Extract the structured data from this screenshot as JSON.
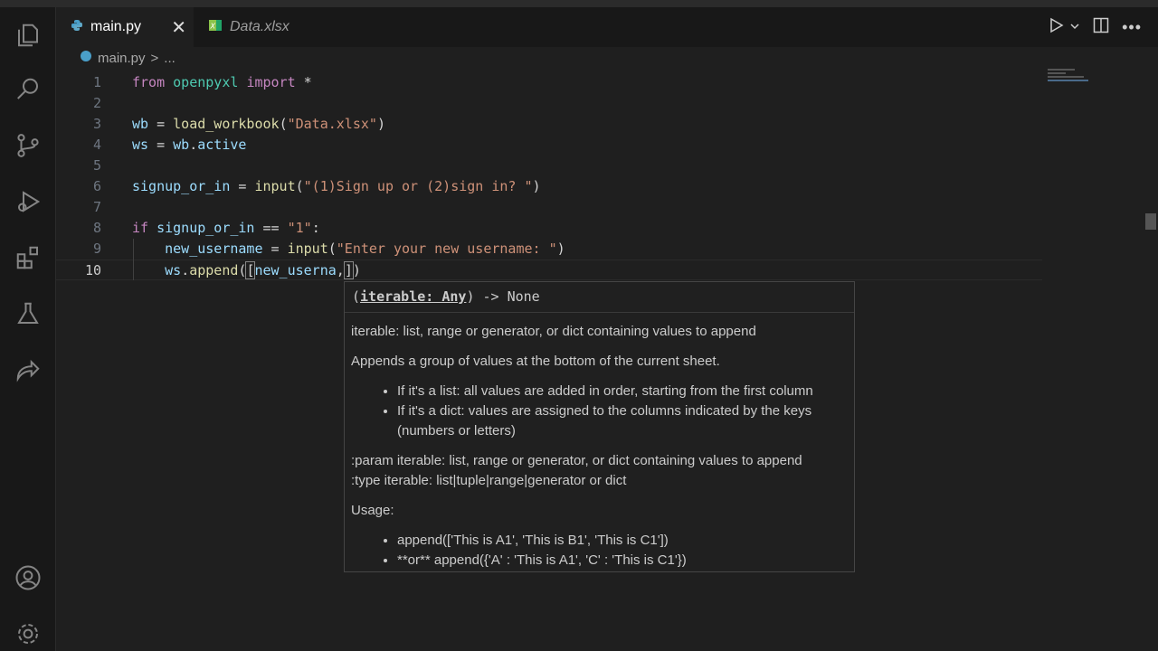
{
  "tabs": [
    {
      "label": "main.py",
      "icon": "python-icon",
      "active": true
    },
    {
      "label": "Data.xlsx",
      "icon": "excel-icon",
      "active": false
    }
  ],
  "breadcrumb": {
    "file": "main.py",
    "sep": ">",
    "rest": "..."
  },
  "lines": [
    "1",
    "2",
    "3",
    "4",
    "5",
    "6",
    "7",
    "8",
    "9",
    "10"
  ],
  "code": {
    "l1": [
      "from",
      " ",
      "openpyxl",
      " ",
      "import",
      " *"
    ],
    "l3": [
      "wb",
      " = ",
      "load_workbook",
      "(",
      "\"Data.xlsx\"",
      ")"
    ],
    "l4": [
      "ws",
      " = ",
      "wb",
      ".",
      "active"
    ],
    "l6": [
      "signup_or_in",
      " = ",
      "input",
      "(",
      "\"(1)Sign up or (2)sign in? \"",
      ")"
    ],
    "l8": [
      "if",
      " ",
      "signup_or_in",
      " == ",
      "\"1\"",
      ":"
    ],
    "l9": [
      "    ",
      "new_username",
      " = ",
      "input",
      "(",
      "\"Enter your new username: \"",
      ")"
    ],
    "l10": [
      "    ",
      "ws",
      ".",
      "append",
      "(",
      "[",
      "new_userna",
      ",",
      "]",
      ")"
    ]
  },
  "hover": {
    "sig_open": "(",
    "sig_param": "iterable: Any",
    "sig_close": ") -> None",
    "p1": "iterable: list, range or generator, or dict containing values to append",
    "p2": "Appends a group of values at the bottom of the current sheet.",
    "b1": "If it's a list: all values are added in order, starting from the first column",
    "b2": "If it's a dict: values are assigned to the columns indicated by the keys (numbers or letters)",
    "p3a": ":param iterable: list, range or generator, or dict containing values to append",
    "p3b": ":type iterable: list|tuple|range|generator or dict",
    "p4": "Usage:",
    "u1": "append(['This is A1', 'This is B1', 'This is C1'])",
    "u2": "**or** append({'A' : 'This is A1', 'C' : 'This is C1'})"
  },
  "colors": {
    "keyword": "#c586c0",
    "module": "#4ec9b0",
    "function": "#dcdcaa",
    "string": "#ce9178",
    "variable": "#9cdcfe"
  }
}
